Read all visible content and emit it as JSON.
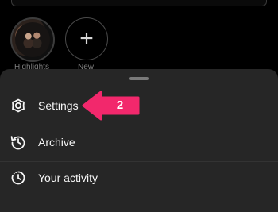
{
  "highlights": {
    "items": [
      {
        "label": "Highlights"
      },
      {
        "label": "New"
      }
    ]
  },
  "sheet": {
    "menu": [
      {
        "label": "Settings",
        "icon": "settings-gear-icon"
      },
      {
        "label": "Archive",
        "icon": "archive-clock-icon"
      },
      {
        "label": "Your activity",
        "icon": "activity-icon"
      }
    ]
  },
  "annotation": {
    "step": "2",
    "color": "#f2286c"
  }
}
